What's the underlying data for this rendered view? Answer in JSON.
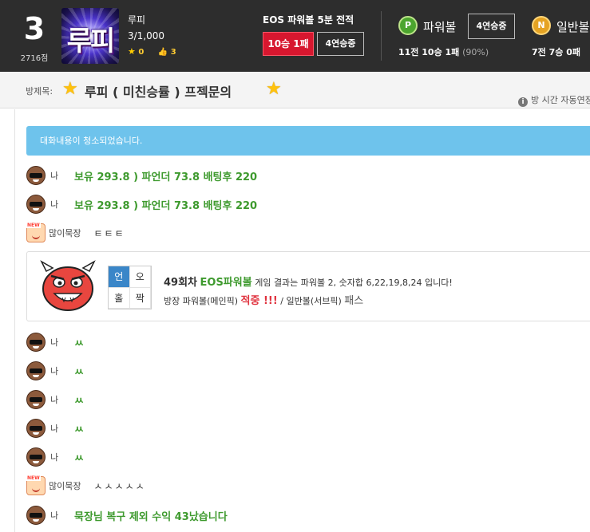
{
  "header": {
    "rank": "3",
    "score": "2716점",
    "profile_text": "루피",
    "nickname": "루피",
    "level": "3/1,000",
    "stars": "0",
    "likes": "3",
    "eos_title": "EOS 파워볼 5분 전적",
    "eos_record_badge": "10승 1패",
    "eos_streak_badge": "4연승중",
    "powerball": {
      "icon_letter": "P",
      "label": "파워볼",
      "streak": "4연승중",
      "record": "11전 10승 1패",
      "pct": "(90%)"
    },
    "normalball": {
      "icon_letter": "N",
      "label": "일반볼",
      "record": "7전 7승 0패"
    }
  },
  "room": {
    "label": "방제목:",
    "title": "루피 ( 미친승률 ) 프젝문의",
    "info": "방 시간 자동연장"
  },
  "chat": {
    "notice": "대화내용이 청소되었습니다.",
    "messages": [
      {
        "sender": "나",
        "text": "보유 293.8 ) 파언더 73.8 배팅후 220"
      },
      {
        "sender": "나",
        "text": "보유 293.8 ) 파언더 73.8 배팅후 220"
      },
      {
        "sender": "많이묵장",
        "text": "ㅌㅌㅌ"
      },
      {
        "sender": "나",
        "text": "ㅆ"
      },
      {
        "sender": "나",
        "text": "ㅆ"
      },
      {
        "sender": "나",
        "text": "ㅆ"
      },
      {
        "sender": "나",
        "text": "ㅆ"
      },
      {
        "sender": "나",
        "text": "ㅆ"
      },
      {
        "sender": "많이묵장",
        "text": "ㅅㅅㅅㅅㅅ"
      },
      {
        "sender": "나",
        "text": "묵장님 복구 제외 수익 43났습니다"
      }
    ],
    "new_tag": "NEW",
    "result": {
      "grid": [
        "언",
        "오",
        "홀",
        "짝"
      ],
      "round": "49회차",
      "game": "EOS파워볼",
      "text1": "게임 결과는 파워볼 2, 숫자합 6,22,19,8,24 입니다!",
      "pick_text": "방장 파워볼(메인픽)",
      "hit": "적중 !!!",
      "sep": " / 일반볼(서브픽)",
      "miss": "패스"
    }
  },
  "colors": {
    "header_bg": "#2d2d2d",
    "badge_red": "#d7172f",
    "notice_bg": "#6ec3ec",
    "chat_green": "#3e9a2e",
    "hit_red": "#e0333f"
  }
}
